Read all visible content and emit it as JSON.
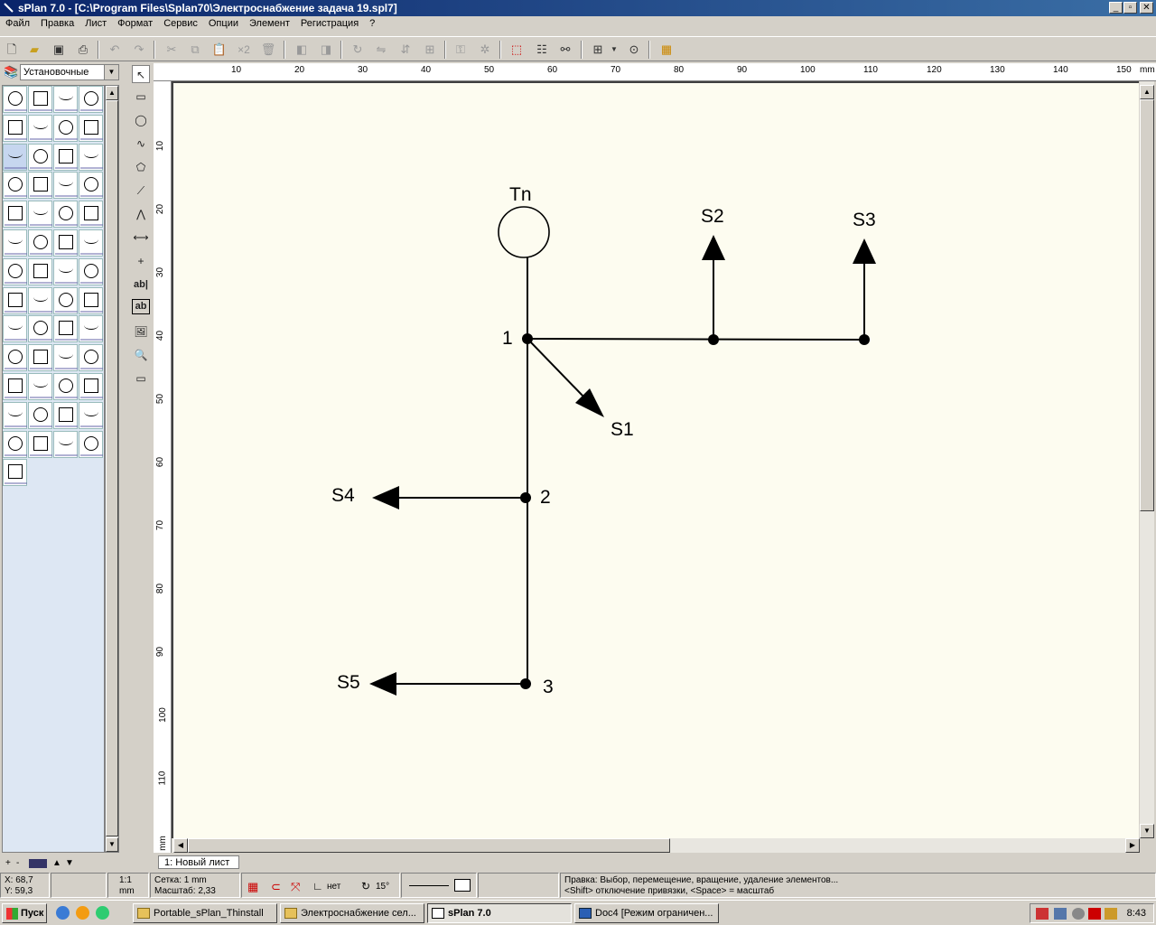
{
  "window": {
    "title": "sPlan 7.0 - [C:\\Program Files\\Splan70\\Электроснабжение задача 19.spl7]"
  },
  "menu": [
    "Файл",
    "Правка",
    "Лист",
    "Формат",
    "Сервис",
    "Опции",
    "Элемент",
    "Регистрация",
    "?"
  ],
  "toolbar": {
    "multiply_label": "×2"
  },
  "library": {
    "selected": "Установочные"
  },
  "tools": {
    "text_label": "ab|",
    "text2_label": "ab"
  },
  "ruler": {
    "unit": "mm",
    "top": [
      "10",
      "20",
      "30",
      "40",
      "50",
      "60",
      "70",
      "80",
      "90",
      "100",
      "110",
      "120",
      "130",
      "140",
      "150"
    ],
    "left": [
      "10",
      "20",
      "30",
      "40",
      "50",
      "60",
      "70",
      "80",
      "90",
      "100",
      "110"
    ],
    "left_unit": "mm"
  },
  "schematic": {
    "labels": {
      "tn": "Tn",
      "s1": "S1",
      "s2": "S2",
      "s3": "S3",
      "s4": "S4",
      "s5": "S5",
      "n1": "1",
      "n2": "2",
      "n3": "3"
    }
  },
  "sheet_tab": "1: Новый лист",
  "status": {
    "x": "X: 68,7",
    "y": "Y: 59,3",
    "scale_ratio": "1:1",
    "scale_unit": "mm",
    "grid": "Сетка: 1 mm",
    "zoom": "Масштаб:  2,33",
    "snap": "нет",
    "angle": "15°",
    "hint1": "Правка: Выбор, перемещение, вращение, удаление элементов...",
    "hint2": "<Shift> отключение привязки, <Space> = масштаб"
  },
  "taskbar": {
    "start": "Пуск",
    "tasks": [
      "Portable_sPlan_Thinstall",
      "Электроснабжение сел...",
      "sPlan 7.0",
      "Doc4 [Режим ограничен..."
    ],
    "clock": "8:43"
  }
}
